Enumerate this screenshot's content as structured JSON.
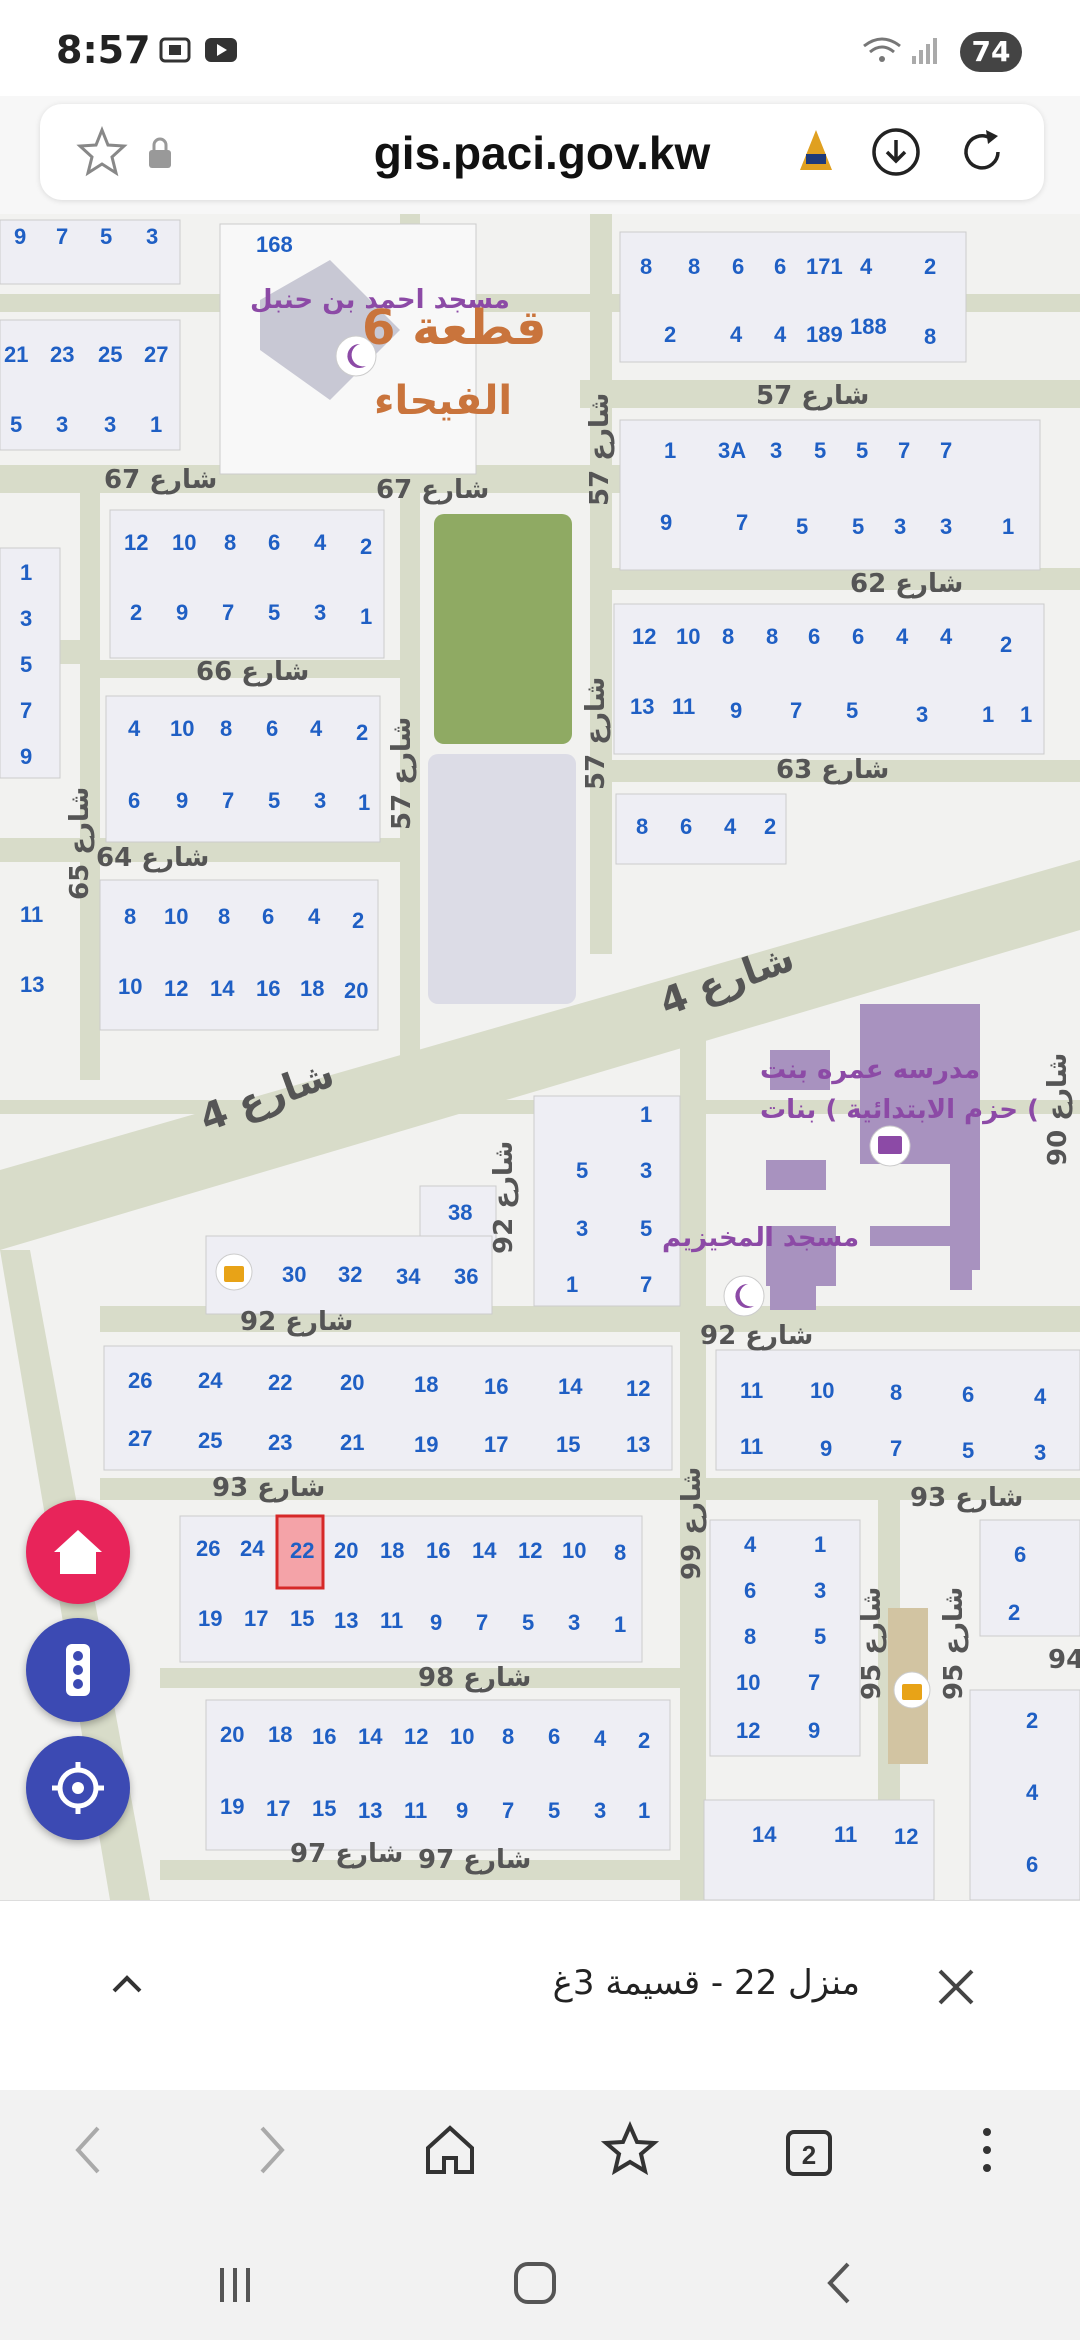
{
  "status_bar": {
    "time": "8:57",
    "battery": "74"
  },
  "browser": {
    "url": "gis.paci.gov.kw"
  },
  "map": {
    "labels": {
      "mosque1": "مسجد احمد بن حنبل",
      "block": "قطعة 6",
      "area": "الفيحاء",
      "school": "مدرسه عمره بنت",
      "school2": "حزم الابتدائية ) بنات (",
      "mosque2": "مسجد المخيزيم"
    },
    "streets": {
      "s57a": "شارع 57",
      "s67a": "شارع 67",
      "s67b": "شارع 67",
      "s57b": "شارع 57",
      "s62": "شارع 62",
      "s66": "شارع 66",
      "s57c": "شارع 57",
      "s57d": "شارع 57",
      "s63": "شارع 63",
      "s65": "شارع 65",
      "s64": "شارع 64",
      "s4a": "شارع 4",
      "s4b": "شارع 4",
      "s92a": "شارع 92",
      "s90": "شارع 90",
      "s92b": "شارع 92",
      "s92c": "شارع 92",
      "s93a": "شارع 93",
      "s93b": "شارع 93",
      "s99": "شارع 99",
      "s95a": "شارع 95",
      "s95b": "شارع 95",
      "s98": "شارع 98",
      "s97a": "شارع 97",
      "s97b": "شارع 97",
      "s94": "94"
    },
    "selected_plot": "22"
  },
  "info_panel": {
    "title": "منزل 22 - قسيمة 3غ"
  },
  "colors": {
    "fab_home": "#e8245a",
    "fab_secondary": "#3c4ab3",
    "selected": "#f4a3a8",
    "park": "#8faa63",
    "building": "#a892bf"
  }
}
